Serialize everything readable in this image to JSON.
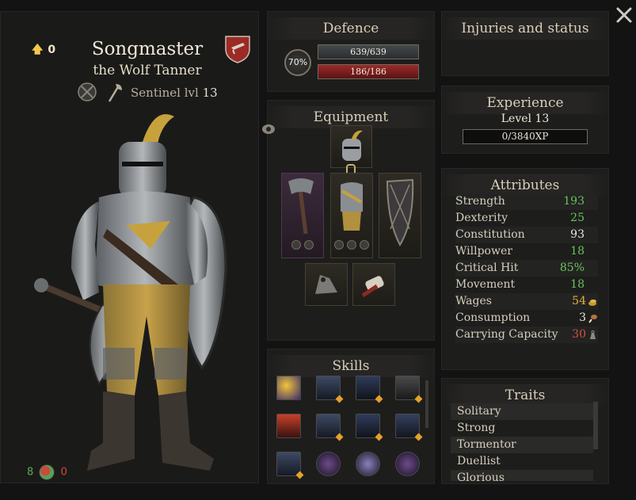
{
  "header": {
    "level_up_points": "0",
    "name": "Songmaster",
    "title": "the Wolf Tanner",
    "class_label": "Sentinel lvl",
    "class_level": "13"
  },
  "mood": {
    "positive": "8",
    "negative": "0"
  },
  "defence": {
    "title": "Defence",
    "percent": "70%",
    "armor": "639/639",
    "health": "186/186"
  },
  "injuries": {
    "title": "Injuries and status"
  },
  "experience": {
    "title": "Experience",
    "level": "Level 13",
    "xp": "0/3840XP"
  },
  "equipment": {
    "title": "Equipment"
  },
  "skills": {
    "title": "Skills"
  },
  "attributes": {
    "title": "Attributes",
    "items": [
      {
        "label": "Strength",
        "value": "193",
        "color": "#6bc25c"
      },
      {
        "label": "Dexterity",
        "value": "25",
        "color": "#6bc25c"
      },
      {
        "label": "Constitution",
        "value": "93",
        "color": "#ece6d8"
      },
      {
        "label": "Willpower",
        "value": "18",
        "color": "#6bc25c"
      },
      {
        "label": "Critical Hit",
        "value": "85%",
        "color": "#6bc25c"
      },
      {
        "label": "Movement",
        "value": "18",
        "color": "#6bc25c"
      },
      {
        "label": "Wages",
        "value": "54",
        "color": "#e5b341",
        "icon": "coin-icon"
      },
      {
        "label": "Consumption",
        "value": "3",
        "color": "#ece6d8",
        "icon": "drumstick-icon"
      },
      {
        "label": "Carrying Capacity",
        "value": "30",
        "color": "#d4533d",
        "icon": "weight-icon"
      }
    ]
  },
  "traits": {
    "title": "Traits",
    "items": [
      "Solitary",
      "Strong",
      "Tormentor",
      "Duellist",
      "Glorious"
    ]
  }
}
